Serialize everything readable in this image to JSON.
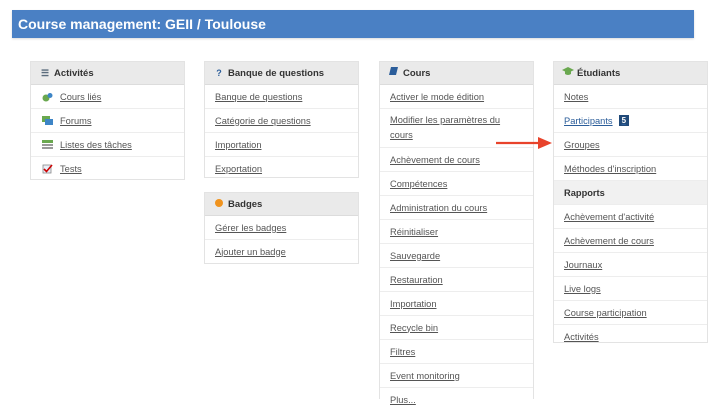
{
  "header": {
    "title": "Course management: GEII / Toulouse"
  },
  "panels": {
    "activites": {
      "title": "Activités",
      "items": [
        {
          "label": "Cours liés",
          "icon": "linked-courses-icon"
        },
        {
          "label": "Forums",
          "icon": "forum-icon"
        },
        {
          "label": "Listes des tâches",
          "icon": "task-list-icon"
        },
        {
          "label": "Tests",
          "icon": "quiz-icon"
        }
      ]
    },
    "banque": {
      "title": "Banque de questions",
      "items": [
        {
          "label": "Banque de questions"
        },
        {
          "label": "Catégorie de questions"
        },
        {
          "label": "Importation"
        },
        {
          "label": "Exportation"
        }
      ]
    },
    "badges": {
      "title": "Badges",
      "items": [
        {
          "label": "Gérer les badges"
        },
        {
          "label": "Ajouter un badge"
        }
      ]
    },
    "cours": {
      "title": "Cours",
      "items": [
        {
          "label": "Activer le mode édition"
        },
        {
          "label": "Modifier les paramètres du cours"
        },
        {
          "label": "Achèvement de cours"
        },
        {
          "label": "Compétences"
        },
        {
          "label": "Administration du cours"
        },
        {
          "label": "Réinitialiser"
        },
        {
          "label": "Sauvegarde"
        },
        {
          "label": "Restauration"
        },
        {
          "label": "Importation"
        },
        {
          "label": "Recycle bin"
        },
        {
          "label": "Filtres"
        },
        {
          "label": "Event monitoring"
        },
        {
          "label": "Plus..."
        }
      ]
    },
    "etudiants": {
      "title": "Étudiants",
      "items": [
        {
          "label": "Notes"
        },
        {
          "label": "Participants",
          "badge": "5"
        },
        {
          "label": "Groupes"
        },
        {
          "label": "Méthodes d'inscription"
        }
      ],
      "rapports_title": "Rapports",
      "rapports": [
        {
          "label": "Achèvement d'activité"
        },
        {
          "label": "Achèvement de cours"
        },
        {
          "label": "Journaux"
        },
        {
          "label": "Live logs"
        },
        {
          "label": "Course participation"
        },
        {
          "label": "Activités"
        }
      ]
    }
  },
  "colors": {
    "header_bg": "#4a80c4",
    "arrow": "#e8432b",
    "badge_bg": "#214a79"
  }
}
